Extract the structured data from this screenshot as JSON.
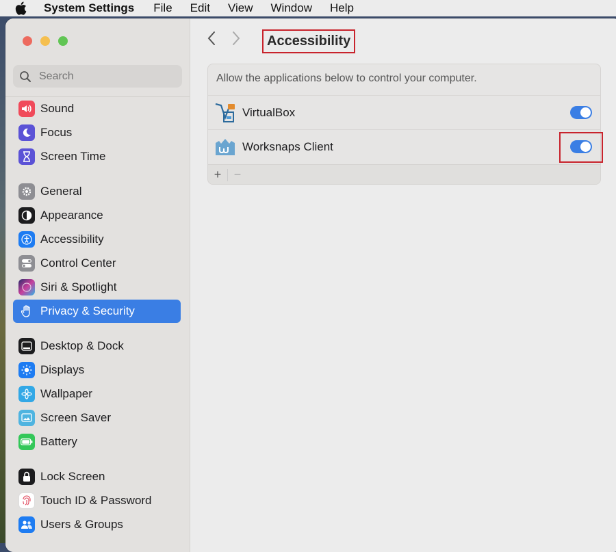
{
  "menubar": {
    "app": "System Settings",
    "items": [
      "File",
      "Edit",
      "View",
      "Window",
      "Help"
    ]
  },
  "sidebar": {
    "search_placeholder": "Search",
    "items": [
      {
        "label": "Sound",
        "icon": "speaker-icon",
        "color": "#f04a5a"
      },
      {
        "label": "Focus",
        "icon": "moon-icon",
        "color": "#5b52d6"
      },
      {
        "label": "Screen Time",
        "icon": "hourglass-icon",
        "color": "#5b52d6"
      },
      {
        "label": "General",
        "icon": "gear-icon",
        "color": "#8e8e93"
      },
      {
        "label": "Appearance",
        "icon": "appearance-icon",
        "color": "#1c1c1e"
      },
      {
        "label": "Accessibility",
        "icon": "accessibility-icon",
        "color": "#1e7cf2"
      },
      {
        "label": "Control Center",
        "icon": "toggles-icon",
        "color": "#8e8e93"
      },
      {
        "label": "Siri & Spotlight",
        "icon": "siri-icon",
        "color": "#c83f9c"
      },
      {
        "label": "Privacy & Security",
        "icon": "hand-icon",
        "color": "#3a7ee4",
        "active": true
      },
      {
        "label": "Desktop & Dock",
        "icon": "dock-icon",
        "color": "#1c1c1e"
      },
      {
        "label": "Displays",
        "icon": "sun-icon",
        "color": "#1e7cf2"
      },
      {
        "label": "Wallpaper",
        "icon": "flower-icon",
        "color": "#32a8e6"
      },
      {
        "label": "Screen Saver",
        "icon": "screensaver-icon",
        "color": "#4fb4e0"
      },
      {
        "label": "Battery",
        "icon": "battery-icon",
        "color": "#34c759"
      },
      {
        "label": "Lock Screen",
        "icon": "lock-icon",
        "color": "#1c1c1e"
      },
      {
        "label": "Touch ID & Password",
        "icon": "fingerprint-icon",
        "color": "#ffffff"
      },
      {
        "label": "Users & Groups",
        "icon": "users-icon",
        "color": "#1e7cf2"
      }
    ]
  },
  "content": {
    "title": "Accessibility",
    "description": "Allow the applications below to control your computer.",
    "apps": [
      {
        "name": "VirtualBox",
        "enabled": true
      },
      {
        "name": "Worksnaps Client",
        "enabled": true
      }
    ],
    "add_label": "+",
    "remove_label": "−"
  },
  "colors": {
    "accent": "#3a7ee4",
    "highlight": "#c8232c"
  }
}
